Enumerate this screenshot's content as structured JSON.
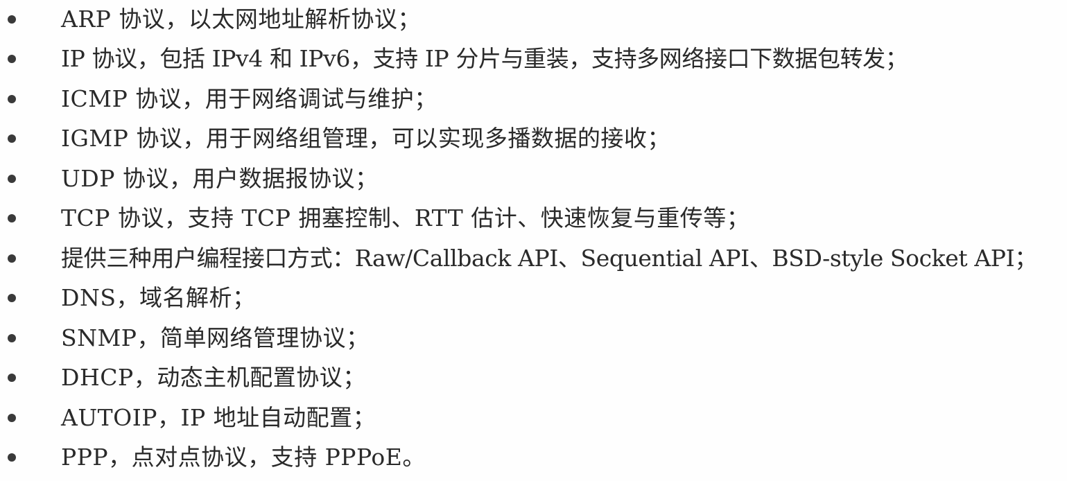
{
  "list": {
    "items": [
      "ARP 协议，以太网地址解析协议；",
      "IP 协议，包括 IPv4 和 IPv6，支持 IP 分片与重装，支持多网络接口下数据包转发；",
      "ICMP 协议，用于网络调试与维护；",
      "IGMP 协议，用于网络组管理，可以实现多播数据的接收；",
      "UDP 协议，用户数据报协议；",
      "TCP 协议，支持 TCP 拥塞控制、RTT 估计、快速恢复与重传等；",
      "提供三种用户编程接口方式：Raw/Callback API、Sequential API、BSD-style Socket API；",
      "DNS，域名解析；",
      "SNMP，简单网络管理协议；",
      "DHCP，动态主机配置协议；",
      "AUTOIP，IP 地址自动配置；",
      "PPP，点对点协议，支持 PPPoE。"
    ]
  }
}
